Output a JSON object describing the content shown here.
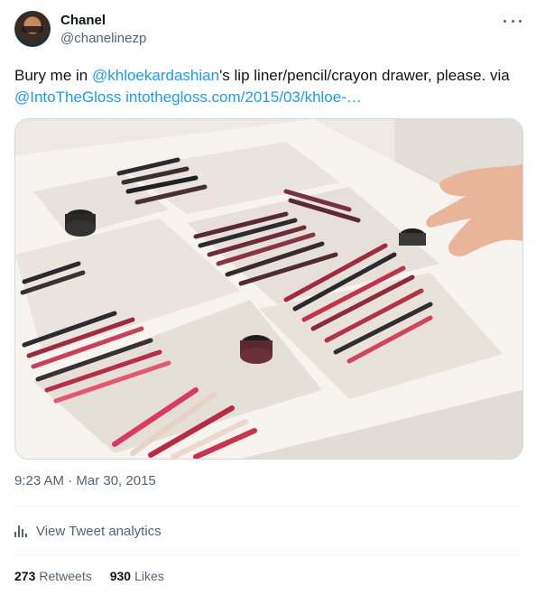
{
  "author": {
    "name": "Chanel",
    "handle": "@chanelinezp",
    "avatar_icon": "avatar-photo"
  },
  "tweet": {
    "text_before": "Bury me in ",
    "mention": "@khloekardashian",
    "text_after": "'s lip liner/pencil/crayon drawer, please. via",
    "via_mention": "@IntoTheGloss",
    "url": "intothegloss.com/2015/03/khloe-…"
  },
  "timestamp": "9:23 AM · Mar 30, 2015",
  "analytics": {
    "label": "View Tweet analytics",
    "icon": "bar-chart-icon"
  },
  "stats": {
    "retweets_count": "273",
    "retweets_label": "Retweets",
    "likes_count": "930",
    "likes_label": "Likes"
  },
  "colors": {
    "link": "#1d9bf0",
    "secondary_text": "#536471"
  }
}
